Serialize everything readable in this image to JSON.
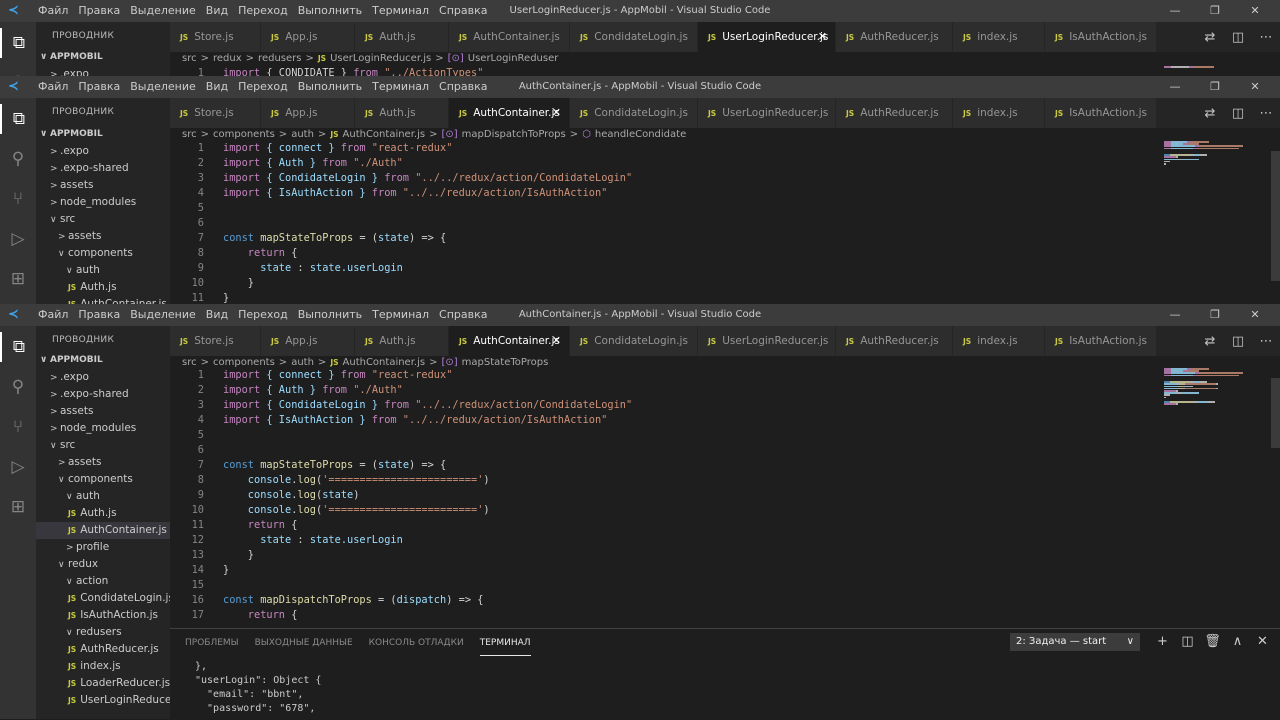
{
  "menu": [
    "Файл",
    "Правка",
    "Выделение",
    "Вид",
    "Переход",
    "Выполнить",
    "Терминал",
    "Справка"
  ],
  "explorer_title": "ПРОВОДНИК",
  "project": "APPMOBIL",
  "window_buttons": [
    "—",
    "❐",
    "✕"
  ],
  "editor_actions": [
    "⇄",
    "◫",
    "⋯"
  ],
  "windows": [
    {
      "title": "UserLoginReducer.js - AppMobil - Visual Studio Code",
      "tabs": [
        {
          "label": "Store.js"
        },
        {
          "label": "App.js"
        },
        {
          "label": "Auth.js"
        },
        {
          "label": "AuthContainer.js"
        },
        {
          "label": "CondidateLogin.js"
        },
        {
          "label": "UserLoginReducer.js",
          "active": true,
          "close": "✕"
        },
        {
          "label": "AuthReducer.js"
        },
        {
          "label": "index.js"
        },
        {
          "label": "IsAuthAction.js"
        }
      ],
      "breadcrumb": [
        "src",
        ">",
        "redux",
        ">",
        "redusers",
        ">",
        "JS",
        "UserLoginReducer.js",
        ">",
        "[⊙]",
        "UserLoginReduser"
      ],
      "tree": [
        {
          "label": "APPMOBIL",
          "arrow": "∨",
          "head": true
        },
        {
          "label": ".expo",
          "arrow": ">"
        }
      ],
      "code": [
        {
          "n": "1",
          "segs": [
            {
              "t": "import",
              "c": "#c586c0"
            },
            {
              "t": " { CONDIDATE } ",
              "c": "#d4d4d4"
            },
            {
              "t": "from",
              "c": "#c586c0"
            },
            {
              "t": " \"../ActionTypes\"",
              "c": "#ce9178"
            }
          ]
        }
      ]
    },
    {
      "title": "AuthContainer.js - AppMobil - Visual Studio Code",
      "tabs": [
        {
          "label": "Store.js"
        },
        {
          "label": "App.js"
        },
        {
          "label": "Auth.js"
        },
        {
          "label": "AuthContainer.js",
          "active": true,
          "close": "✕"
        },
        {
          "label": "CondidateLogin.js"
        },
        {
          "label": "UserLoginReducer.js"
        },
        {
          "label": "AuthReducer.js"
        },
        {
          "label": "index.js"
        },
        {
          "label": "IsAuthAction.js"
        }
      ],
      "breadcrumb": [
        "src",
        ">",
        "components",
        ">",
        "auth",
        ">",
        "JS",
        "AuthContainer.js",
        ">",
        "[⊙]",
        "mapDispatchToProps",
        ">",
        "⬡",
        "heandleCondidate"
      ],
      "tree": [
        {
          "label": "APPMOBIL",
          "arrow": "∨",
          "head": true
        },
        {
          "label": ".expo",
          "arrow": ">"
        },
        {
          "label": ".expo-shared",
          "arrow": ">"
        },
        {
          "label": "assets",
          "arrow": ">"
        },
        {
          "label": "node_modules",
          "arrow": ">"
        },
        {
          "label": "src",
          "arrow": "∨"
        },
        {
          "label": "assets",
          "arrow": ">",
          "depth": 1
        },
        {
          "label": "components",
          "arrow": "∨",
          "depth": 1
        },
        {
          "label": "auth",
          "arrow": "∨",
          "depth": 2
        },
        {
          "label": "Auth.js",
          "js": "JS",
          "depth": 2
        },
        {
          "label": "AuthContainer.js",
          "js": "JS",
          "depth": 2
        }
      ],
      "code": [
        {
          "n": "1",
          "segs": [
            {
              "t": "import",
              "c": "#c586c0"
            },
            {
              "t": " { connect } ",
              "c": "#9cdcfe"
            },
            {
              "t": "from",
              "c": "#c586c0"
            },
            {
              "t": " \"react-redux\"",
              "c": "#ce9178"
            }
          ]
        },
        {
          "n": "2",
          "segs": [
            {
              "t": "import",
              "c": "#c586c0"
            },
            {
              "t": " { Auth } ",
              "c": "#9cdcfe"
            },
            {
              "t": "from",
              "c": "#c586c0"
            },
            {
              "t": " \"./Auth\"",
              "c": "#ce9178"
            }
          ]
        },
        {
          "n": "3",
          "segs": [
            {
              "t": "import",
              "c": "#c586c0"
            },
            {
              "t": " { CondidateLogin } ",
              "c": "#9cdcfe"
            },
            {
              "t": "from",
              "c": "#c586c0"
            },
            {
              "t": " \"../../redux/action/CondidateLogin\"",
              "c": "#ce9178"
            }
          ]
        },
        {
          "n": "4",
          "segs": [
            {
              "t": "import",
              "c": "#c586c0"
            },
            {
              "t": " { IsAuthAction } ",
              "c": "#9cdcfe"
            },
            {
              "t": "from",
              "c": "#c586c0"
            },
            {
              "t": " \"../../redux/action/IsAuthAction\"",
              "c": "#ce9178"
            }
          ]
        },
        {
          "n": "5",
          "segs": []
        },
        {
          "n": "6",
          "segs": []
        },
        {
          "n": "7",
          "segs": [
            {
              "t": "const",
              "c": "#569cd6"
            },
            {
              "t": " mapStateToProps",
              "c": "#dcdcaa"
            },
            {
              "t": " = (",
              "c": "#d4d4d4"
            },
            {
              "t": "state",
              "c": "#9cdcfe"
            },
            {
              "t": ") => {",
              "c": "#d4d4d4"
            }
          ]
        },
        {
          "n": "8",
          "segs": [
            {
              "t": "    return",
              "c": "#c586c0"
            },
            {
              "t": " {",
              "c": "#d4d4d4"
            }
          ]
        },
        {
          "n": "9",
          "segs": [
            {
              "t": "      state",
              "c": "#9cdcfe"
            },
            {
              "t": " : ",
              "c": "#d4d4d4"
            },
            {
              "t": "state",
              "c": "#9cdcfe"
            },
            {
              "t": ".userLogin",
              "c": "#9cdcfe"
            }
          ]
        },
        {
          "n": "10",
          "segs": [
            {
              "t": "    }",
              "c": "#d4d4d4"
            }
          ]
        },
        {
          "n": "11",
          "segs": [
            {
              "t": "}",
              "c": "#d4d4d4"
            }
          ]
        }
      ]
    },
    {
      "title": "AuthContainer.js - AppMobil - Visual Studio Code",
      "tabs": [
        {
          "label": "Store.js"
        },
        {
          "label": "App.js"
        },
        {
          "label": "Auth.js"
        },
        {
          "label": "AuthContainer.js",
          "active": true,
          "close": "✕"
        },
        {
          "label": "CondidateLogin.js"
        },
        {
          "label": "UserLoginReducer.js"
        },
        {
          "label": "AuthReducer.js"
        },
        {
          "label": "index.js"
        },
        {
          "label": "IsAuthAction.js"
        }
      ],
      "breadcrumb": [
        "src",
        ">",
        "components",
        ">",
        "auth",
        ">",
        "JS",
        "AuthContainer.js",
        ">",
        "[⊙]",
        "mapStateToProps"
      ],
      "tree": [
        {
          "label": "APPMOBIL",
          "arrow": "∨",
          "head": true
        },
        {
          "label": ".expo",
          "arrow": ">"
        },
        {
          "label": ".expo-shared",
          "arrow": ">"
        },
        {
          "label": "assets",
          "arrow": ">"
        },
        {
          "label": "node_modules",
          "arrow": ">"
        },
        {
          "label": "src",
          "arrow": "∨"
        },
        {
          "label": "assets",
          "arrow": ">",
          "depth": 1
        },
        {
          "label": "components",
          "arrow": "∨",
          "depth": 1
        },
        {
          "label": "auth",
          "arrow": "∨",
          "depth": 2
        },
        {
          "label": "Auth.js",
          "js": "JS",
          "depth": 2
        },
        {
          "label": "AuthContainer.js",
          "js": "JS",
          "depth": 2,
          "selected": true
        },
        {
          "label": "profile",
          "arrow": ">",
          "depth": 2
        },
        {
          "label": "redux",
          "arrow": "∨",
          "depth": 1
        },
        {
          "label": "action",
          "arrow": "∨",
          "depth": 2
        },
        {
          "label": "CondidateLogin.js",
          "js": "JS",
          "depth": 2
        },
        {
          "label": "IsAuthAction.js",
          "js": "JS",
          "depth": 2
        },
        {
          "label": "redusers",
          "arrow": "∨",
          "depth": 2
        },
        {
          "label": "AuthReducer.js",
          "js": "JS",
          "depth": 2
        },
        {
          "label": "index.js",
          "js": "JS",
          "depth": 2
        },
        {
          "label": "LoaderReducer.js",
          "js": "JS",
          "depth": 2
        },
        {
          "label": "UserLoginReduce...",
          "js": "JS",
          "depth": 2
        }
      ],
      "code": [
        {
          "n": "1",
          "segs": [
            {
              "t": "import",
              "c": "#c586c0"
            },
            {
              "t": " { connect } ",
              "c": "#9cdcfe"
            },
            {
              "t": "from",
              "c": "#c586c0"
            },
            {
              "t": " \"react-redux\"",
              "c": "#ce9178"
            }
          ]
        },
        {
          "n": "2",
          "segs": [
            {
              "t": "import",
              "c": "#c586c0"
            },
            {
              "t": " { Auth } ",
              "c": "#9cdcfe"
            },
            {
              "t": "from",
              "c": "#c586c0"
            },
            {
              "t": " \"./Auth\"",
              "c": "#ce9178"
            }
          ]
        },
        {
          "n": "3",
          "segs": [
            {
              "t": "import",
              "c": "#c586c0"
            },
            {
              "t": " { CondidateLogin } ",
              "c": "#9cdcfe"
            },
            {
              "t": "from",
              "c": "#c586c0"
            },
            {
              "t": " \"../../redux/action/CondidateLogin\"",
              "c": "#ce9178"
            }
          ]
        },
        {
          "n": "4",
          "segs": [
            {
              "t": "import",
              "c": "#c586c0"
            },
            {
              "t": " { IsAuthAction } ",
              "c": "#9cdcfe"
            },
            {
              "t": "from",
              "c": "#c586c0"
            },
            {
              "t": " \"../../redux/action/IsAuthAction\"",
              "c": "#ce9178"
            }
          ]
        },
        {
          "n": "5",
          "segs": []
        },
        {
          "n": "6",
          "segs": []
        },
        {
          "n": "7",
          "segs": [
            {
              "t": "const",
              "c": "#569cd6"
            },
            {
              "t": " mapStateToProps",
              "c": "#dcdcaa"
            },
            {
              "t": " = (",
              "c": "#d4d4d4"
            },
            {
              "t": "state",
              "c": "#9cdcfe"
            },
            {
              "t": ") => {",
              "c": "#d4d4d4"
            }
          ]
        },
        {
          "n": "8",
          "segs": [
            {
              "t": "    console",
              "c": "#9cdcfe"
            },
            {
              "t": ".",
              "c": "#d4d4d4"
            },
            {
              "t": "log",
              "c": "#dcdcaa"
            },
            {
              "t": "(",
              "c": "#d4d4d4"
            },
            {
              "t": "'========================'",
              "c": "#ce9178"
            },
            {
              "t": ")",
              "c": "#d4d4d4"
            }
          ]
        },
        {
          "n": "9",
          "segs": [
            {
              "t": "    console",
              "c": "#9cdcfe"
            },
            {
              "t": ".",
              "c": "#d4d4d4"
            },
            {
              "t": "log",
              "c": "#dcdcaa"
            },
            {
              "t": "(",
              "c": "#d4d4d4"
            },
            {
              "t": "state",
              "c": "#9cdcfe"
            },
            {
              "t": ")",
              "c": "#d4d4d4"
            }
          ]
        },
        {
          "n": "10",
          "segs": [
            {
              "t": "    console",
              "c": "#9cdcfe"
            },
            {
              "t": ".",
              "c": "#d4d4d4"
            },
            {
              "t": "log",
              "c": "#dcdcaa"
            },
            {
              "t": "(",
              "c": "#d4d4d4"
            },
            {
              "t": "'========================'",
              "c": "#ce9178"
            },
            {
              "t": ")",
              "c": "#d4d4d4"
            }
          ]
        },
        {
          "n": "11",
          "segs": [
            {
              "t": "    return",
              "c": "#c586c0"
            },
            {
              "t": " {",
              "c": "#d4d4d4"
            }
          ]
        },
        {
          "n": "12",
          "segs": [
            {
              "t": "      state",
              "c": "#9cdcfe"
            },
            {
              "t": " : ",
              "c": "#d4d4d4"
            },
            {
              "t": "state",
              "c": "#9cdcfe"
            },
            {
              "t": ".userLogin",
              "c": "#9cdcfe"
            }
          ]
        },
        {
          "n": "13",
          "segs": [
            {
              "t": "    }",
              "c": "#d4d4d4"
            }
          ]
        },
        {
          "n": "14",
          "segs": [
            {
              "t": "}",
              "c": "#d4d4d4"
            }
          ]
        },
        {
          "n": "15",
          "segs": []
        },
        {
          "n": "16",
          "segs": [
            {
              "t": "const",
              "c": "#569cd6"
            },
            {
              "t": " mapDispatchToProps",
              "c": "#dcdcaa"
            },
            {
              "t": " = (",
              "c": "#d4d4d4"
            },
            {
              "t": "dispatch",
              "c": "#9cdcfe"
            },
            {
              "t": ") => {",
              "c": "#d4d4d4"
            }
          ]
        },
        {
          "n": "17",
          "segs": [
            {
              "t": "    return",
              "c": "#c586c0"
            },
            {
              "t": " {",
              "c": "#d4d4d4"
            }
          ]
        }
      ]
    }
  ],
  "panel": {
    "tabs": [
      "ПРОБЛЕМЫ",
      "ВЫХОДНЫЕ ДАННЫЕ",
      "КОНСОЛЬ ОТЛАДКИ",
      "ТЕРМИНАЛ"
    ],
    "active_tab": "ТЕРМИНАЛ",
    "terminal_select": "2: Задача — start",
    "terminal_select_chevron": "∨",
    "icons": [
      "+",
      "◫",
      "🗑",
      "∧",
      "✕"
    ],
    "lines": [
      "},",
      "\"userLogin\": Object {",
      "  \"email\": \"bbnt\",",
      "  \"password\": \"678\","
    ]
  },
  "colors": {
    "keyword": "#c586c0",
    "string": "#ce9178",
    "variable": "#9cdcfe",
    "function": "#dcdcaa",
    "storage": "#569cd6",
    "js_icon": "#cbcb41"
  }
}
